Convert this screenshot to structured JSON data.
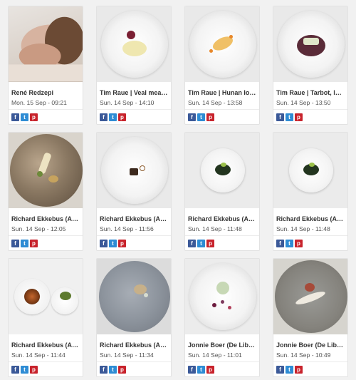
{
  "share": {
    "facebook": "f",
    "twitter": "t",
    "pinterest": "p"
  },
  "cards": [
    {
      "title": "René Redzepi",
      "date": "Mon. 15 Sep - 09:21"
    },
    {
      "title": "Tim Raue | Veal meat...",
      "date": "Sun. 14 Sep - 14:10"
    },
    {
      "title": "Tim Raue | Hunan lob...",
      "date": "Sun. 14 Sep - 13:58"
    },
    {
      "title": "Tim Raue | Tarbot, lee...",
      "date": "Sun. 14 Sep - 13:50"
    },
    {
      "title": "Richard Ekkebus (Am...",
      "date": "Sun. 14 Sep - 12:05"
    },
    {
      "title": "Richard Ekkebus (Am...",
      "date": "Sun. 14 Sep - 11:56"
    },
    {
      "title": "Richard Ekkebus (Am...",
      "date": "Sun. 14 Sep - 11:48"
    },
    {
      "title": "Richard Ekkebus (Am...",
      "date": "Sun. 14 Sep - 11:48"
    },
    {
      "title": "Richard Ekkebus (Am...",
      "date": "Sun. 14 Sep - 11:44"
    },
    {
      "title": "Richard Ekkebus (Am...",
      "date": "Sun. 14 Sep - 11:34"
    },
    {
      "title": "Jonnie Boer (De Librij...",
      "date": "Sun. 14 Sep - 11:01"
    },
    {
      "title": "Jonnie Boer (De Librij...",
      "date": "Sun. 14 Sep - 10:49"
    }
  ]
}
